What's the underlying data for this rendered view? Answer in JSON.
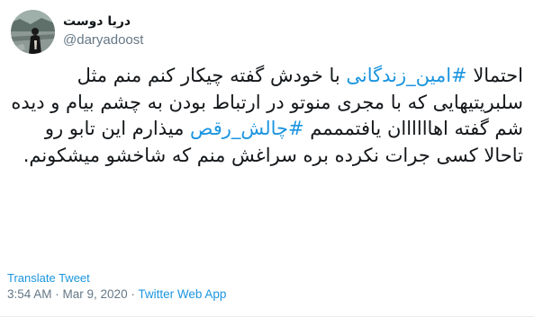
{
  "author": {
    "display_name": "دریا دوست",
    "handle": "@daryadoost",
    "avatar_icon": "profile-photo"
  },
  "tweet": {
    "parts": [
      {
        "type": "text",
        "text": "احتمالا "
      },
      {
        "type": "hashtag",
        "text": "#امین_زندگانی"
      },
      {
        "type": "text",
        "text": " با خودش گفته چیکار کنم منم مثل سلبریتیهایی که با مجری منوتو در ارتباط بودن به چشم بیام و دیده شم گفته اهاااااان یافتمممم "
      },
      {
        "type": "hashtag",
        "text": "#چالش_رقص"
      },
      {
        "type": "text",
        "text": " میذارم این تابو رو تاحالا کسی جرات نکرده بره سراغش منم که شاخشو میشکونم."
      }
    ]
  },
  "translate_label": "Translate Tweet",
  "meta": {
    "time": "3:54 AM",
    "separator": " · ",
    "date": "Mar 9, 2020",
    "source": "Twitter Web App"
  },
  "colors": {
    "link": "#1b95e0",
    "text": "#14171a",
    "muted": "#657786"
  }
}
